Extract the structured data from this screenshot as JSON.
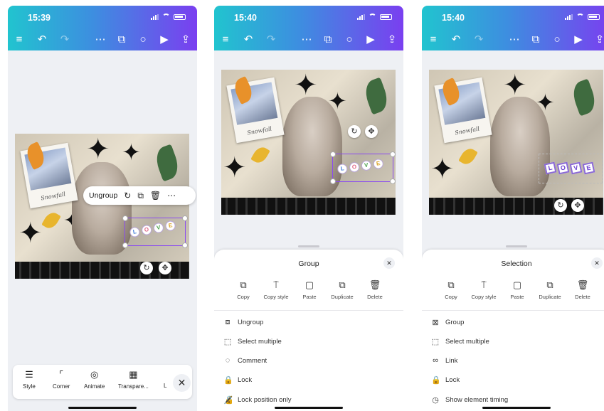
{
  "phone1": {
    "time": "15:39",
    "context_menu": {
      "ungroup_label": "Ungroup"
    },
    "bottom_toolbar": {
      "items": [
        {
          "label": "Style"
        },
        {
          "label": "Corner"
        },
        {
          "label": "Animate"
        },
        {
          "label": "Transpare..."
        },
        {
          "label": "L"
        }
      ]
    }
  },
  "phone2": {
    "time": "15:40",
    "sheet_title": "Group",
    "actions": [
      {
        "label": "Copy"
      },
      {
        "label": "Copy style"
      },
      {
        "label": "Paste"
      },
      {
        "label": "Duplicate"
      },
      {
        "label": "Delete"
      }
    ],
    "menu": [
      {
        "label": "Ungroup"
      },
      {
        "label": "Select multiple"
      },
      {
        "label": "Comment"
      },
      {
        "label": "Lock"
      },
      {
        "label": "Lock position only"
      }
    ]
  },
  "phone3": {
    "time": "15:40",
    "sheet_title": "Selection",
    "actions": [
      {
        "label": "Copy"
      },
      {
        "label": "Copy style"
      },
      {
        "label": "Paste"
      },
      {
        "label": "Duplicate"
      },
      {
        "label": "Delete"
      }
    ],
    "menu": [
      {
        "label": "Group"
      },
      {
        "label": "Select multiple"
      },
      {
        "label": "Link"
      },
      {
        "label": "Lock"
      },
      {
        "label": "Show element timing"
      }
    ]
  },
  "design": {
    "word": [
      "L",
      "O",
      "V",
      "E"
    ],
    "polaroid_caption": "Snowfall"
  },
  "colors": {
    "header_start": "#21c4cf",
    "header_end": "#7a3ff0",
    "selection": "#8a4bf0"
  }
}
